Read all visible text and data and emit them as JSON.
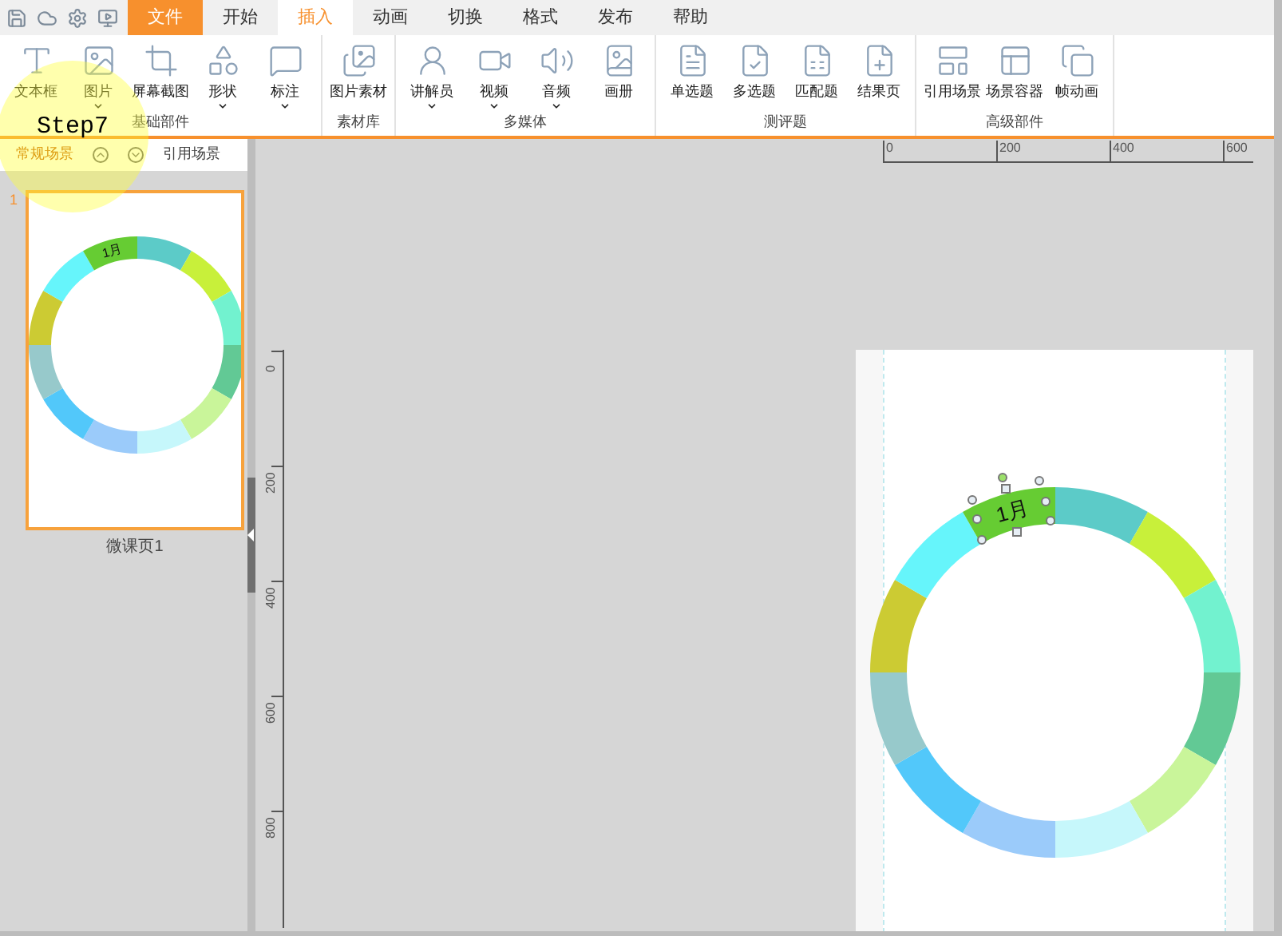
{
  "tabs": [
    {
      "label": "文件",
      "kind": "file",
      "selected": false
    },
    {
      "label": "开始",
      "kind": "tab",
      "selected": false
    },
    {
      "label": "插入",
      "kind": "tab",
      "selected": true
    },
    {
      "label": "动画",
      "kind": "tab",
      "selected": false
    },
    {
      "label": "切换",
      "kind": "tab",
      "selected": false
    },
    {
      "label": "格式",
      "kind": "tab",
      "selected": false
    },
    {
      "label": "发布",
      "kind": "tab",
      "selected": false
    },
    {
      "label": "帮助",
      "kind": "tab",
      "selected": false
    }
  ],
  "ribbon_groups": [
    {
      "title": "基础部件",
      "items": [
        {
          "label": "文本框",
          "dropdown": false
        },
        {
          "label": "图片",
          "dropdown": true
        },
        {
          "label": "屏幕截图",
          "dropdown": false
        },
        {
          "label": "形状",
          "dropdown": true
        },
        {
          "label": "标注",
          "dropdown": true
        }
      ]
    },
    {
      "title": "素材库",
      "items": [
        {
          "label": "图片素材",
          "dropdown": false
        }
      ]
    },
    {
      "title": "多媒体",
      "items": [
        {
          "label": "讲解员",
          "dropdown": true
        },
        {
          "label": "视频",
          "dropdown": true
        },
        {
          "label": "音频",
          "dropdown": true
        },
        {
          "label": "画册",
          "dropdown": false
        }
      ]
    },
    {
      "title": "测评题",
      "items": [
        {
          "label": "单选题",
          "dropdown": false
        },
        {
          "label": "多选题",
          "dropdown": false
        },
        {
          "label": "匹配题",
          "dropdown": false
        },
        {
          "label": "结果页",
          "dropdown": false
        }
      ]
    },
    {
      "title": "高级部件",
      "items": [
        {
          "label": "引用场景",
          "dropdown": false
        },
        {
          "label": "场景容器",
          "dropdown": false
        },
        {
          "label": "帧动画",
          "dropdown": false
        }
      ]
    }
  ],
  "scene_tabs": [
    {
      "label": "常规场景",
      "selected": true
    },
    {
      "label": "引用场景",
      "selected": false
    }
  ],
  "slides": [
    {
      "number": "1",
      "caption": "微课页1",
      "selected": true,
      "ring_label": "1月"
    }
  ],
  "ruler": {
    "horizontal": [
      "0",
      "200",
      "400",
      "600"
    ],
    "vertical": [
      "0",
      "200",
      "400",
      "600",
      "800"
    ]
  },
  "ring": {
    "segments": [
      {
        "color": "#5ccbc8"
      },
      {
        "color": "#c8f03a"
      },
      {
        "color": "#72f2cf"
      },
      {
        "color": "#62c995"
      },
      {
        "color": "#c9f59a"
      },
      {
        "color": "#c6f7fb"
      },
      {
        "color": "#9bcbfa"
      },
      {
        "color": "#52c8fa"
      },
      {
        "color": "#97c9cb"
      },
      {
        "color": "#cccb33"
      },
      {
        "color": "#66f5fb"
      },
      {
        "color": "#66cc33",
        "label": "1月"
      }
    ]
  },
  "annotation": {
    "text": "Step7"
  }
}
